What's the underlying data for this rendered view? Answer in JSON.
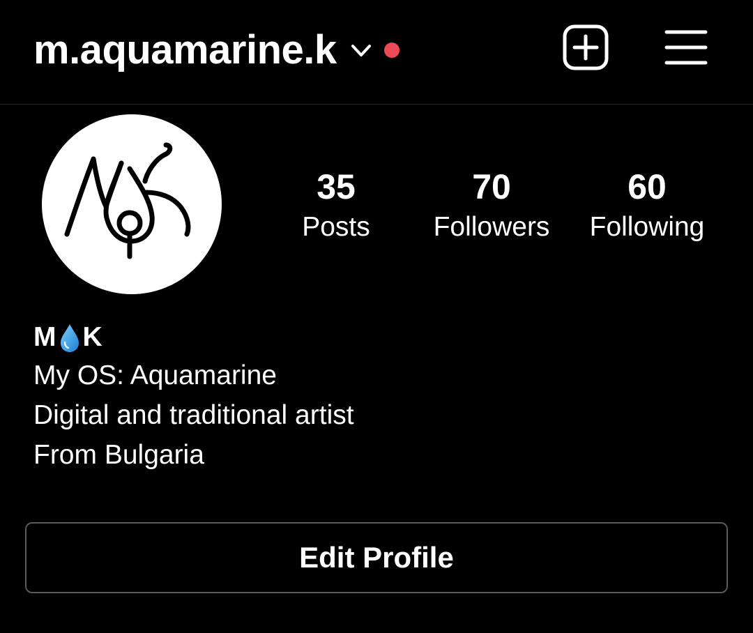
{
  "header": {
    "username": "m.aquamarine.k",
    "icons": {
      "switch_account": "chevron-down-icon",
      "notification": "notification-dot",
      "new_post": "plus-square-icon",
      "menu": "hamburger-menu-icon"
    }
  },
  "profile": {
    "avatar": "MK monogram logo",
    "stats": [
      {
        "value": "35",
        "label": "Posts"
      },
      {
        "value": "70",
        "label": "Followers"
      },
      {
        "value": "60",
        "label": "Following"
      }
    ],
    "display_name": {
      "first": "M",
      "emoji": "droplet-emoji",
      "last": "K"
    },
    "bio_lines": [
      "My OS: Aquamarine",
      "Digital and traditional artist",
      "From Bulgaria"
    ]
  },
  "actions": {
    "edit_profile": "Edit Profile"
  },
  "colors": {
    "background": "#000000",
    "text": "#ffffff",
    "notification_dot": "#ed4956",
    "button_border": "#5a5a5a",
    "divider": "#262626",
    "droplet": "#2f9ee6"
  }
}
